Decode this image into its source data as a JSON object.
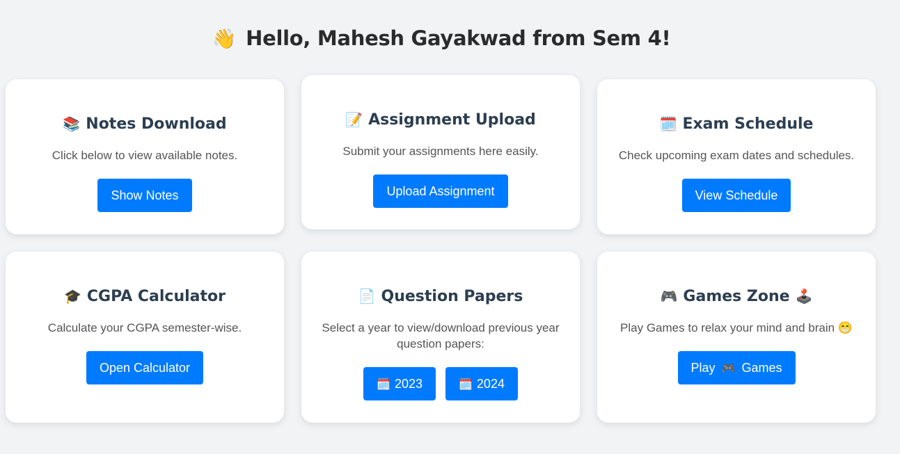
{
  "header": {
    "wave_emoji": "👋",
    "greeting": "Hello, Mahesh Gayakwad from Sem 4!"
  },
  "cards": [
    {
      "emoji": "📚",
      "title": "Notes Download",
      "description": "Click below to view available notes.",
      "button": "Show Notes"
    },
    {
      "emoji": "📝",
      "title": "Assignment Upload",
      "description": "Submit your assignments here easily.",
      "button": "Upload Assignment"
    },
    {
      "emoji": "🗓️",
      "title": "Exam Schedule",
      "description": "Check upcoming exam dates and schedules.",
      "button": "View Schedule"
    },
    {
      "emoji": "🎓",
      "title": "CGPA Calculator",
      "description": "Calculate your CGPA semester-wise.",
      "button": "Open Calculator"
    },
    {
      "emoji": "📄",
      "title": "Question Papers",
      "description": "Select a year to view/download previous year question papers:",
      "year_emoji": "🗓️",
      "years": [
        "2023",
        "2024"
      ]
    },
    {
      "emoji": "🎮",
      "emoji_after": "🕹️",
      "title": "Games Zone",
      "description": "Play Games to relax your mind and brain 😁",
      "button_prefix": "Play",
      "button_emoji": "🎮",
      "button_suffix": "Games"
    }
  ]
}
